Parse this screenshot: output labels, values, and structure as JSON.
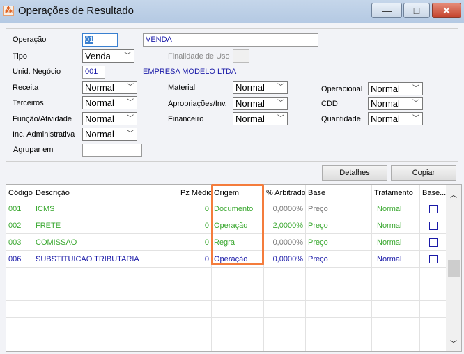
{
  "window": {
    "title": "Operações de Resultado",
    "minimize": "—",
    "maximize": "□",
    "close": "✕"
  },
  "form": {
    "operacao_label": "Operação",
    "operacao_code": "01",
    "operacao_desc": "VENDA",
    "tipo_label": "Tipo",
    "tipo_value": "Venda",
    "finalidade_label": "Finalidade de Uso",
    "unid_label": "Unid. Negócio",
    "unid_code": "001",
    "unid_name": "EMPRESA MODELO LTDA",
    "receita_label": "Receita",
    "receita_value": "Normal",
    "terceiros_label": "Terceiros",
    "terceiros_value": "Normal",
    "funcao_label": "Função/Atividade",
    "funcao_value": "Normal",
    "inc_label": "Inc. Administrativa",
    "inc_value": "Normal",
    "agrupar_label": "Agrupar em",
    "agrupar_value": "",
    "material_label": "Material",
    "material_value": "Normal",
    "apropriacoes_label": "Apropriações/Inv.",
    "apropriacoes_value": "Normal",
    "financeiro_label": "Financeiro",
    "financeiro_value": "Normal",
    "operacional_label": "Operacional",
    "operacional_value": "Normal",
    "cdd_label": "CDD",
    "cdd_value": "Normal",
    "quantidade_label": "Quantidade",
    "quantidade_value": "Normal"
  },
  "buttons": {
    "detalhes": "Detalhes",
    "copiar": "Copiar"
  },
  "grid": {
    "headers": [
      "Código",
      "Descrição",
      "Pz Médio",
      "Origem",
      "% Arbitrado",
      "Base",
      "Tratamento",
      "Base..."
    ],
    "rows": [
      {
        "codigo": "001",
        "descricao": "ICMS",
        "pz": "0",
        "origem": "Documento",
        "arbitrado": "0,0000%",
        "base": "Preço",
        "tratamento": "Normal"
      },
      {
        "codigo": "002",
        "descricao": "FRETE",
        "pz": "0",
        "origem": "Operação",
        "arbitrado": "2,0000%",
        "base": "Preço",
        "tratamento": "Normal"
      },
      {
        "codigo": "003",
        "descricao": "COMISSAO",
        "pz": "0",
        "origem": "Regra",
        "arbitrado": "0,0000%",
        "base": "Preço",
        "tratamento": "Normal"
      },
      {
        "codigo": "006",
        "descricao": "SUBSTITUICAO TRIBUTARIA",
        "pz": "0",
        "origem": "Operação",
        "arbitrado": "0,0000%",
        "base": "Preço",
        "tratamento": "Normal"
      }
    ]
  },
  "colors": {
    "highlight": "#f47c3c",
    "green": "#3aa830",
    "blue": "#1a1aa8"
  }
}
